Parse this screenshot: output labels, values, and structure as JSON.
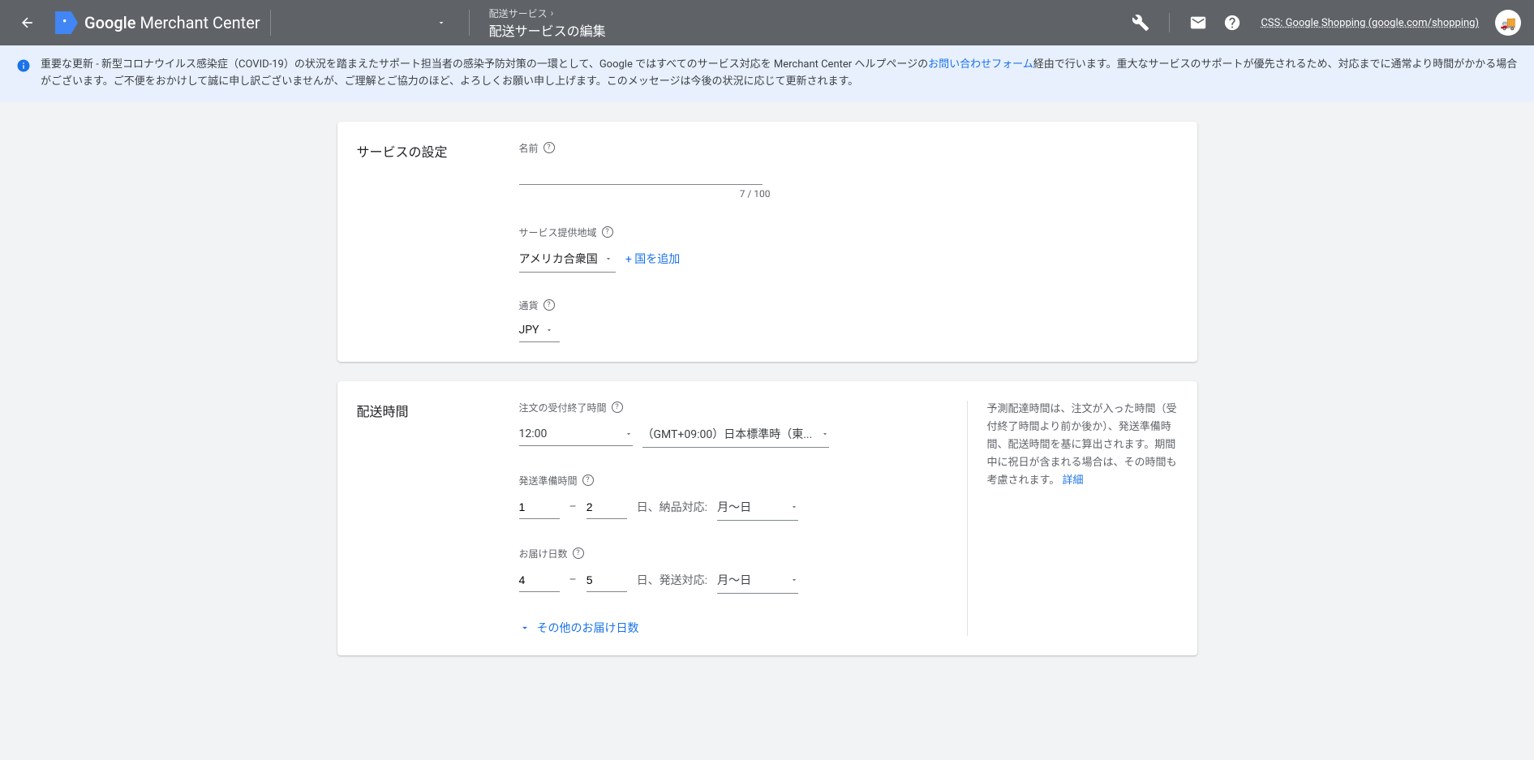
{
  "header": {
    "product_name_bold": "Google",
    "product_name_light": "Merchant Center",
    "breadcrumb_parent": "配送サービス",
    "breadcrumb_title": "配送サービスの編集",
    "css_link": "CSS: Google Shopping (google.com/shopping)"
  },
  "notice": {
    "text_before_link": "重要な更新 - 新型コロナウイルス感染症（COVID-19）の状況を踏まえたサポート担当者の感染予防対策の一環として、Google ではすべてのサービス対応を Merchant Center ヘルプページの",
    "link_text": "お問い合わせフォーム",
    "text_after_link": "経由で行います。重大なサービスのサポートが優先されるため、対応までに通常より時間がかかる場合がございます。ご不便をおかけして誠に申し訳ございませんが、ご理解とご協力のほど、よろしくお願い申し上げます。このメッセージは今後の状況に応じて更新されます。"
  },
  "card1": {
    "title": "サービスの設定",
    "name_label": "名前",
    "name_value": "",
    "counter": "7 / 100",
    "region_label": "サービス提供地域",
    "region_value": "アメリカ合衆国",
    "add_country": "国を追加",
    "currency_label": "通貨",
    "currency_value": "JPY"
  },
  "card2": {
    "title": "配送時間",
    "cutoff_label": "注文の受付終了時間",
    "cutoff_time": "12:00",
    "timezone": "（GMT+09:00）日本標準時（東...",
    "handling_label": "発送準備時間",
    "handling_min": "1",
    "handling_max": "2",
    "handling_suffix": "日、納品対応:",
    "handling_days": "月〜日",
    "transit_label": "お届け日数",
    "transit_min": "4",
    "transit_max": "5",
    "transit_suffix": "日、発送対応:",
    "transit_days": "月〜日",
    "more_transit": "その他のお届け日数",
    "side_text": "予測配達時間は、注文が入った時間（受付終了時間より前か後か）、発送準備時間、配送時間を基に算出されます。期間中に祝日が含まれる場合は、その時間も考慮されます。",
    "side_link": "詳細"
  }
}
